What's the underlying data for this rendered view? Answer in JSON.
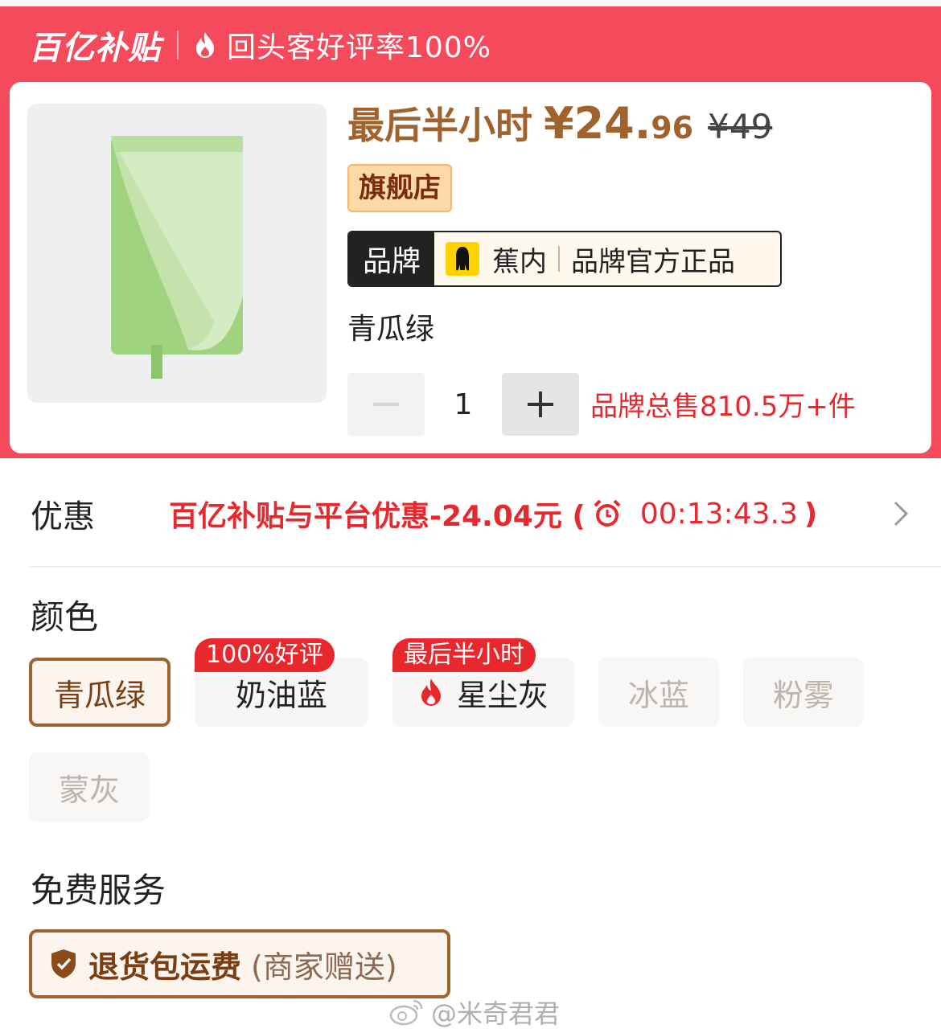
{
  "banner": {
    "logo_text": "百亿补贴",
    "review_text": "回头客好评率100%",
    "bg_color": "#f54a5c"
  },
  "product": {
    "image_icon": "green-towel-image",
    "price_prefix": "最后半小时",
    "price_main": "¥24.",
    "price_cents": "96",
    "original_price": "¥49",
    "shop_tag": "旗舰店",
    "brand": {
      "label": "品牌",
      "logo_icon": "jiaonei-logo-icon",
      "name": "蕉内",
      "official": "品牌官方正品"
    },
    "variant": "青瓜绿",
    "quantity": "1",
    "total_sold": "品牌总售810.5万+件"
  },
  "promo": {
    "label": "优惠",
    "text": "百亿补贴与平台优惠-24.04元 (",
    "timer": "00:13:43.3",
    "close_paren": ")",
    "chevron_icon": "chevron-right-icon",
    "color": "#e8282d"
  },
  "color_section": {
    "title": "颜色",
    "options": [
      {
        "label": "青瓜绿",
        "state": "selected",
        "badge": ""
      },
      {
        "label": "奶油蓝",
        "state": "normal",
        "badge": "100%好评"
      },
      {
        "label": "星尘灰",
        "state": "normal",
        "badge": "最后半小时"
      },
      {
        "label": "冰蓝",
        "state": "disabled",
        "badge": ""
      },
      {
        "label": "粉雾",
        "state": "disabled",
        "badge": ""
      },
      {
        "label": "蒙灰",
        "state": "disabled",
        "badge": ""
      }
    ]
  },
  "service_section": {
    "title": "免费服务",
    "main": "退货包运费",
    "sub": "(商家赠送)",
    "icon": "shield-check-icon"
  },
  "watermark": "@米奇君君",
  "accent_color": "#a0632d"
}
